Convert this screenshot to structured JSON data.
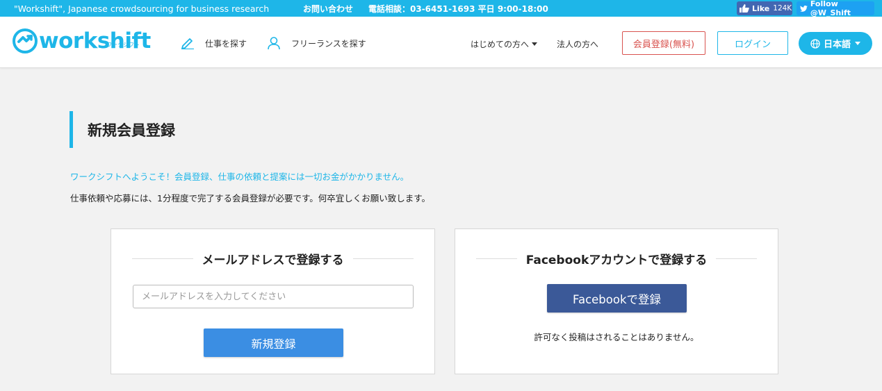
{
  "topbar": {
    "tagline": "\"Workshift\", Japanese crowdsourcing for business research",
    "contact": "お問い合わせ",
    "phone": "電話相談：03-6451-1693 平日 9:00-18:00",
    "fb_like": "Like",
    "fb_count": "124K",
    "tw_follow": "Follow @W_Shift"
  },
  "header": {
    "logo_text": "workshift",
    "logo_sub": "ワークシフト",
    "nav_find_job": "仕事を探す",
    "nav_find_freelancer": "フリーランスを探す",
    "nav_first_time": "はじめての方へ",
    "nav_corporate": "法人の方へ",
    "register_btn": "会員登録(無料)",
    "login_btn": "ログイン",
    "lang_btn": "日本語"
  },
  "main": {
    "title": "新規会員登録",
    "welcome": "ワークシフトへようこそ！会員登録、仕事の依頼と提案には一切お金がかかりません。",
    "notice": "仕事依頼や応募には、1分程度で完了する会員登録が必要です。何卒宜しくお願い致します。"
  },
  "email_card": {
    "title": "メールアドレスで登録する",
    "placeholder": "メールアドレスを入力してください",
    "value": "",
    "submit": "新規登録"
  },
  "fb_card": {
    "title": "Facebookアカウントで登録する",
    "button": "Facebookで登録",
    "note": "許可なく投稿はされることはありません。"
  },
  "colors": {
    "brand": "#1eb6e8",
    "register": "#d9534f",
    "signup": "#3b8ee3",
    "facebook": "#3b5998"
  },
  "icons": [
    "thumbs-up-icon",
    "twitter-bird-icon",
    "pencil-icon",
    "user-icon",
    "globe-icon",
    "chevron-down-icon"
  ]
}
